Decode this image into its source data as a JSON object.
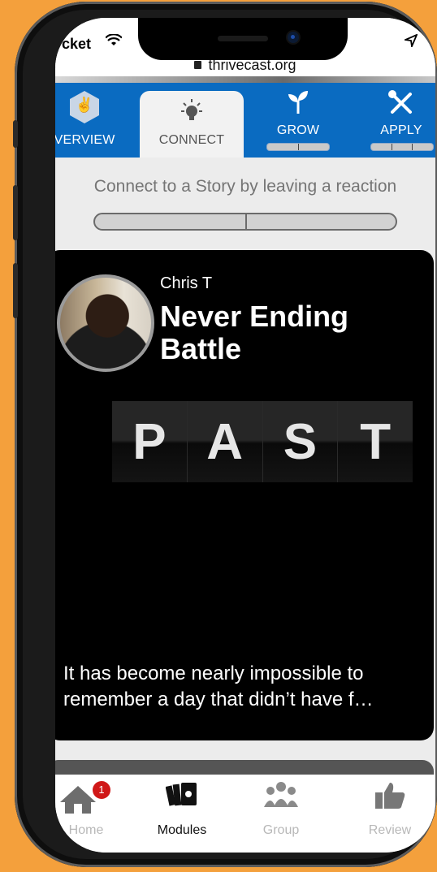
{
  "status_bar": {
    "carrier": "cket",
    "wifi_icon": "wifi-icon",
    "location_icon": "location-arrow-icon"
  },
  "browser": {
    "url": "thrivecast.org"
  },
  "tabs": [
    {
      "label": "OVERVIEW",
      "icon": "hands-icon",
      "active": false
    },
    {
      "label": "CONNECT",
      "icon": "lightbulb-icon",
      "active": true
    },
    {
      "label": "GROW",
      "icon": "sprout-icon",
      "active": false
    },
    {
      "label": "APPLY",
      "icon": "tools-icon",
      "active": false
    }
  ],
  "connect": {
    "prompt": "Connect to a Story by leaving a reaction"
  },
  "story": {
    "author": "Chris T",
    "title": "Never Ending Battle",
    "image_text": [
      "P",
      "A",
      "S",
      "T"
    ],
    "excerpt": "It has become nearly impossible to remember a day that didn’t have f…"
  },
  "bottom_nav": [
    {
      "label": "Home",
      "icon": "home-icon",
      "badge": "1"
    },
    {
      "label": "Modules",
      "icon": "cards-icon"
    },
    {
      "label": "Group",
      "icon": "group-icon"
    },
    {
      "label": "Review",
      "icon": "thumbs-up-icon"
    }
  ],
  "colors": {
    "background": "#f4a03c",
    "tab_bar": "#0a6bc1",
    "card": "#000000",
    "badge": "#d01818"
  }
}
